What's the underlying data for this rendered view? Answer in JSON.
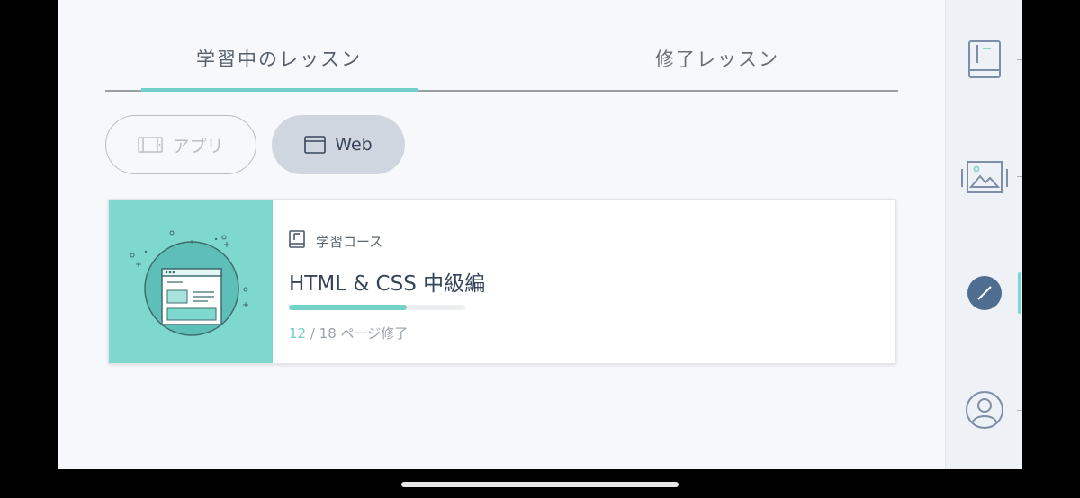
{
  "tabs": {
    "learning": "学習中のレッスン",
    "completed": "修了レッスン"
  },
  "filters": {
    "app_label": "アプリ",
    "web_label": "Web",
    "selected": "Web"
  },
  "course": {
    "type_label": "学習コース",
    "title": "HTML & CSS 中級編",
    "pages_done": "12",
    "pages_total_text": " / 18 ページ修了",
    "progress_fraction": 0.667
  },
  "rail": {
    "items": [
      "book-icon",
      "gallery-icon",
      "pencil-icon",
      "profile-icon"
    ],
    "active": "pencil-icon"
  },
  "colors": {
    "accent": "#73cfc9",
    "thumb_bg": "#7ed8ce",
    "rail_active": "#4f6d8f",
    "title": "#36445a"
  }
}
